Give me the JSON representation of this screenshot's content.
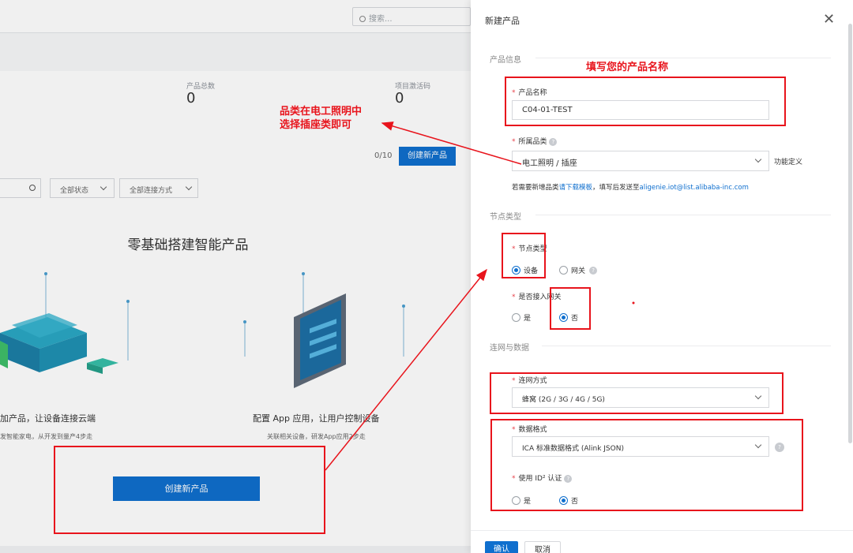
{
  "background": {
    "search_placeholder": "搜索...",
    "stats": [
      {
        "label": "产品总数",
        "value": "0"
      },
      {
        "label": "项目激活码",
        "value": "0"
      }
    ],
    "quota": "0/10",
    "create_button": "创建新产品",
    "filters": {
      "status": "全部状态",
      "connection": "全部连接方式"
    },
    "hero_title": "零基础搭建智能产品",
    "feature_left": {
      "title": "加产品，让设备连接云端",
      "desc": "发智能家电，从开发到量产4步走"
    },
    "feature_right": {
      "title": "配置 App 应用，让用户控制设备",
      "desc": "关联相关设备，研发App应用2步走"
    },
    "big_create_button": "创建新产品"
  },
  "drawer": {
    "title": "新建产品",
    "section_product_info": "产品信息",
    "product_name": {
      "label": "产品名称",
      "value": "C04-01-TEST"
    },
    "category": {
      "label": "所属品类",
      "value": "电工照明 / 插座",
      "side_link": "功能定义"
    },
    "category_hint": {
      "prefix": "若需要新增品类",
      "link": "请下载模板",
      "middle": "，填写后发送至",
      "email": "aligenie.iot@list.alibaba-inc.com"
    },
    "section_node": "节点类型",
    "node_type": {
      "label": "节点类型",
      "options": [
        "设备",
        "网关"
      ],
      "selected": "设备"
    },
    "gateway_access": {
      "label": "是否接入网关",
      "options": [
        "是",
        "否"
      ],
      "selected": "否"
    },
    "section_network": "连网与数据",
    "network_method": {
      "label": "连网方式",
      "value": "蜂窝 (2G / 3G / 4G / 5G)"
    },
    "data_format": {
      "label": "数据格式",
      "value": "ICA 标准数据格式 (Alink JSON)"
    },
    "id2_auth": {
      "label": "使用 ID² 认证",
      "options": [
        "是",
        "否"
      ],
      "selected": "否"
    },
    "confirm_button": "确认",
    "cancel_button": "取消"
  },
  "annotations": {
    "fill_name": "填写您的产品名称",
    "category_line1": "品类在电工照明中",
    "category_line2": "选择插座类即可"
  },
  "colors": {
    "accent": "#0f6fce",
    "annotation_red": "#e8141c",
    "required": "#e6424a"
  }
}
